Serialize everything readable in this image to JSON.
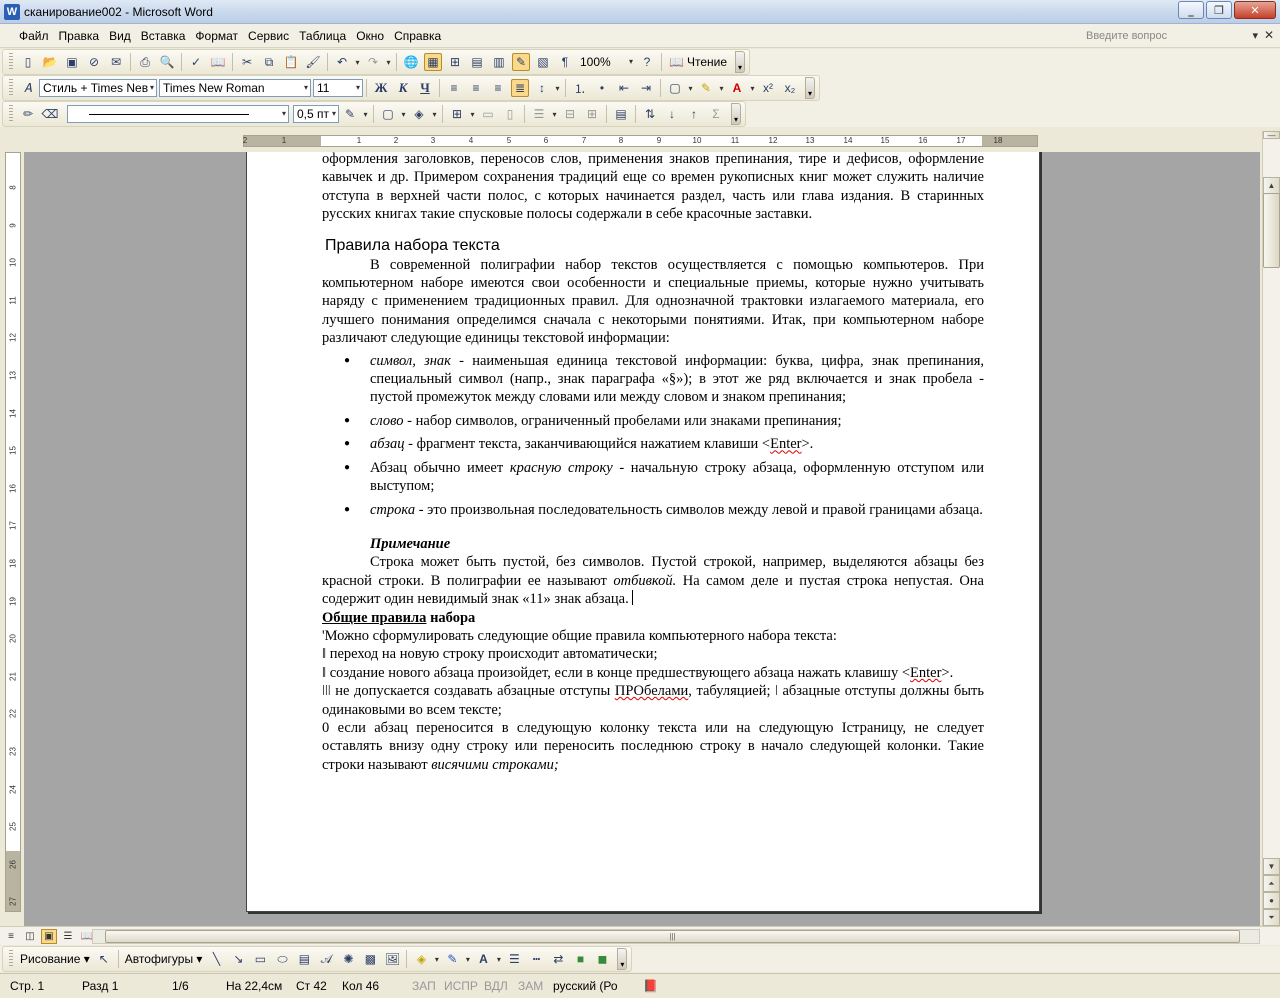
{
  "window": {
    "title": "сканирование002 - Microsoft Word",
    "app_icon": "W"
  },
  "menu": {
    "items": [
      "Файл",
      "Правка",
      "Вид",
      "Вставка",
      "Формат",
      "Сервис",
      "Таблица",
      "Окно",
      "Справка"
    ],
    "help_placeholder": "Введите вопрос"
  },
  "toolbar": {
    "zoom": "100%",
    "reading_label": "Чтение",
    "style": "Стиль + Times Neв",
    "font": "Times New Roman",
    "font_size": "11",
    "bold_label": "Ж",
    "italic_label": "К",
    "underline_label": "Ч",
    "line_weight": "0,5 пт"
  },
  "ruler": {
    "h_ticks": [
      "2",
      "1",
      "1",
      "2",
      "3",
      "4",
      "5",
      "6",
      "7",
      "8",
      "9",
      "10",
      "11",
      "12",
      "13",
      "14",
      "15",
      "16",
      "17",
      "18"
    ],
    "v_ticks": [
      "8",
      "9",
      "10",
      "11",
      "12",
      "13",
      "14",
      "15",
      "16",
      "17",
      "18",
      "19",
      "20",
      "21",
      "22",
      "23",
      "24",
      "25",
      "26",
      "27",
      "28"
    ]
  },
  "document": {
    "intro": "оформления заголовков, переносов слов, применения знаков препинания, тире и дефисов, оформление кавычек и др. Примером сохранения традиций еще со времен рукописных книг может служить наличие отступа в верхней части полос, с которых начинается раздел, часть или глава издания. В старинных русских книгах такие спусковые полосы содержали в себе красочные заставки.",
    "section_title": "Правила набора текста",
    "section_para": "В современной полиграфии набор текстов осуществляется с помощью компьютеров. При компьютерном наборе имеются свои особенности и специальные приемы, которые нужно учитывать наряду с применением традиционных правил. Для однозначной трактовки излагаемого материала, его лучшего понимания определимся сначала с некоторыми понятиями. Итак, при компьютерном наборе различают следующие единицы текстовой информации:",
    "bullets": [
      {
        "term": "символ, знак",
        "text": " - наименьшая единица текстовой информации: буква, цифра, знак препинания, специальный символ (напр., знак параграфа «§»); в этот же ряд включается и знак пробела - пустой промежуток между словами или между словом и знаком препинания;"
      },
      {
        "term": "слово",
        "text": " - набор символов, ограниченный пробелами или знаками препинания;"
      },
      {
        "term": "абзац",
        "text": " - фрагмент текста, заканчивающийся нажатием клавиши <",
        "key": "Enter",
        "tail": ">."
      },
      {
        "pre": "Абзац обычно имеет ",
        "term": "красную строку",
        "text": " - начальную строку абзаца, оформленную отступом или выступом;"
      },
      {
        "term": "строка",
        "text": " - это произвольная последовательность символов между левой и правой границами абзаца."
      }
    ],
    "note_title": "Примечание",
    "note_text_1": "Строка может быть пустой, без символов. Пустой строкой, например, выделяются абзацы без красной строки. В полиграфии ее называют ",
    "note_term": "отбивкой.",
    "note_text_2": " На самом деле и пустая строка непустая. Она содержит один невидимый знак «11» знак абзаца.",
    "rules_heading_u": "Общие правила",
    "rules_heading_rest": " набора",
    "rules_intro": "'Можно сформулировать следующие общие правила компьютерного набора текста:",
    "rule1": "ǁ переход на новую строку происходит автоматически;",
    "rule2_a": "ǁ создание нового абзаца произойдет, если в конце предшествующего абзаца нажать клавишу <",
    "rule2_key": "Enter",
    "rule2_b": ">.",
    "rule3_a": "ǀǀǀ не допускается создавать абзацные отступы ",
    "rule3_word": "ПРОбелами",
    "rule3_b": ", табуляцией; ǀ абзацные отступы должны быть одинаковыми во всем тексте;",
    "rule4_a": "0 если абзац переносится в следующую колонку текста или на следующую Ιстраницу, не следует оставлять внизу одну строку или переносить последнюю строку в начало следующей колонки. Такие строки называют ",
    "rule4_term": "висячими строками;"
  },
  "drawing_toolbar": {
    "draw_label": "Рисование",
    "autoshapes_label": "Автофигуры"
  },
  "status": {
    "page": "Стр. 1",
    "section": "Разд 1",
    "pages": "1/6",
    "at": "На 22,4см",
    "line": "Ст 42",
    "col": "Кол 46",
    "rec": "ЗАП",
    "trk": "ИСПР",
    "ext": "ВДЛ",
    "ovr": "ЗАМ",
    "lang": "русский (Ро"
  }
}
